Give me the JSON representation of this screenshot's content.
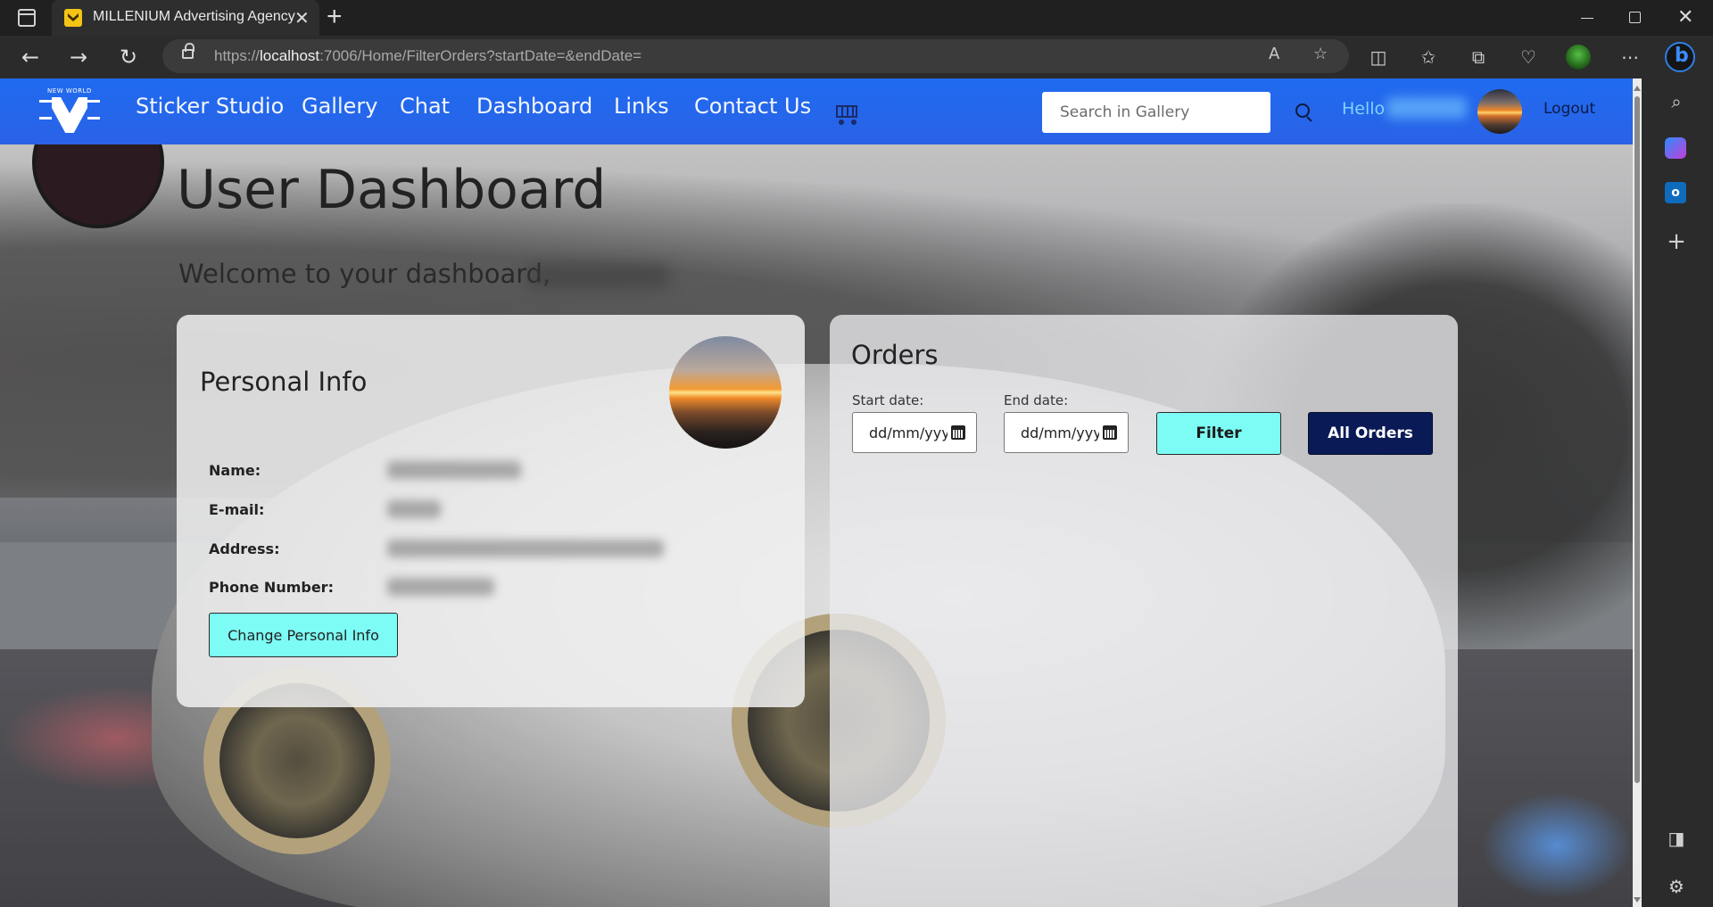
{
  "browser": {
    "tab_title": "MILLENIUM Advertising Agency",
    "url_host": "localhost",
    "url_prefix": "https://",
    "url_rest": ":7006/Home/FilterOrders?startDate=&endDate="
  },
  "navbar": {
    "logo_text": "NEW WORLD",
    "links": [
      "Sticker Studio",
      "Gallery",
      "Chat",
      "Dashboard",
      "Links",
      "Contact Us"
    ],
    "search_placeholder": "Search in Gallery",
    "hello": "Hello",
    "logout": "Logout"
  },
  "page": {
    "title": "User Dashboard",
    "welcome": "Welcome to your dashboard,"
  },
  "personal_info": {
    "title": "Personal Info",
    "labels": [
      "Name:",
      "E-mail:",
      "Address:",
      "Phone Number:"
    ],
    "change_button": "Change Personal Info"
  },
  "orders": {
    "title": "Orders",
    "start_label": "Start date:",
    "end_label": "End date:",
    "start_value": "dd/mm/yyyy",
    "end_value": "dd/mm/yyyy",
    "filter_button": "Filter",
    "all_orders_button": "All Orders"
  },
  "colors": {
    "navbar": "#2a62e6",
    "filter_button": "#7cfcf4",
    "all_orders_button": "#0a1a56",
    "hello_text": "#7ed4ff"
  }
}
